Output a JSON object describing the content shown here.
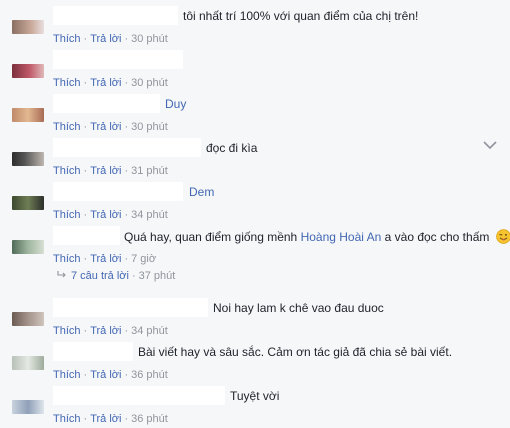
{
  "actions": {
    "like": "Thích",
    "reply": "Trả lời"
  },
  "comments": [
    {
      "text": "tôi nhất trí 100% với quan điểm của chị trên!",
      "time": "30 phút"
    },
    {
      "text": "",
      "time": "30 phút"
    },
    {
      "text": "Duy",
      "time": "30 phút"
    },
    {
      "text": "đọc đi kìa",
      "time": "31 phút"
    },
    {
      "text": "",
      "time": "32 phút"
    },
    {
      "text": "Dem",
      "time": "34 phút"
    },
    {
      "text_before": "Quá hay, quan điểm giống mềnh ",
      "mention": "Hoàng Hoài An",
      "text_after": " a vào đọc cho thấm",
      "emoji": "tongue-wink-emoji",
      "time": "7 giờ"
    },
    {
      "text": "Noi hay lam k chê vao đau duoc",
      "time": "34 phút"
    },
    {
      "text": "Bài viết hay và sâu sắc. Cảm ơn tác giả đã chia sẻ bài viết.",
      "time": "36 phút"
    },
    {
      "text": "Tuyệt vời",
      "time": "36 phút"
    }
  ],
  "replies": {
    "label": "7 câu trả lời",
    "time": "37 phút"
  }
}
